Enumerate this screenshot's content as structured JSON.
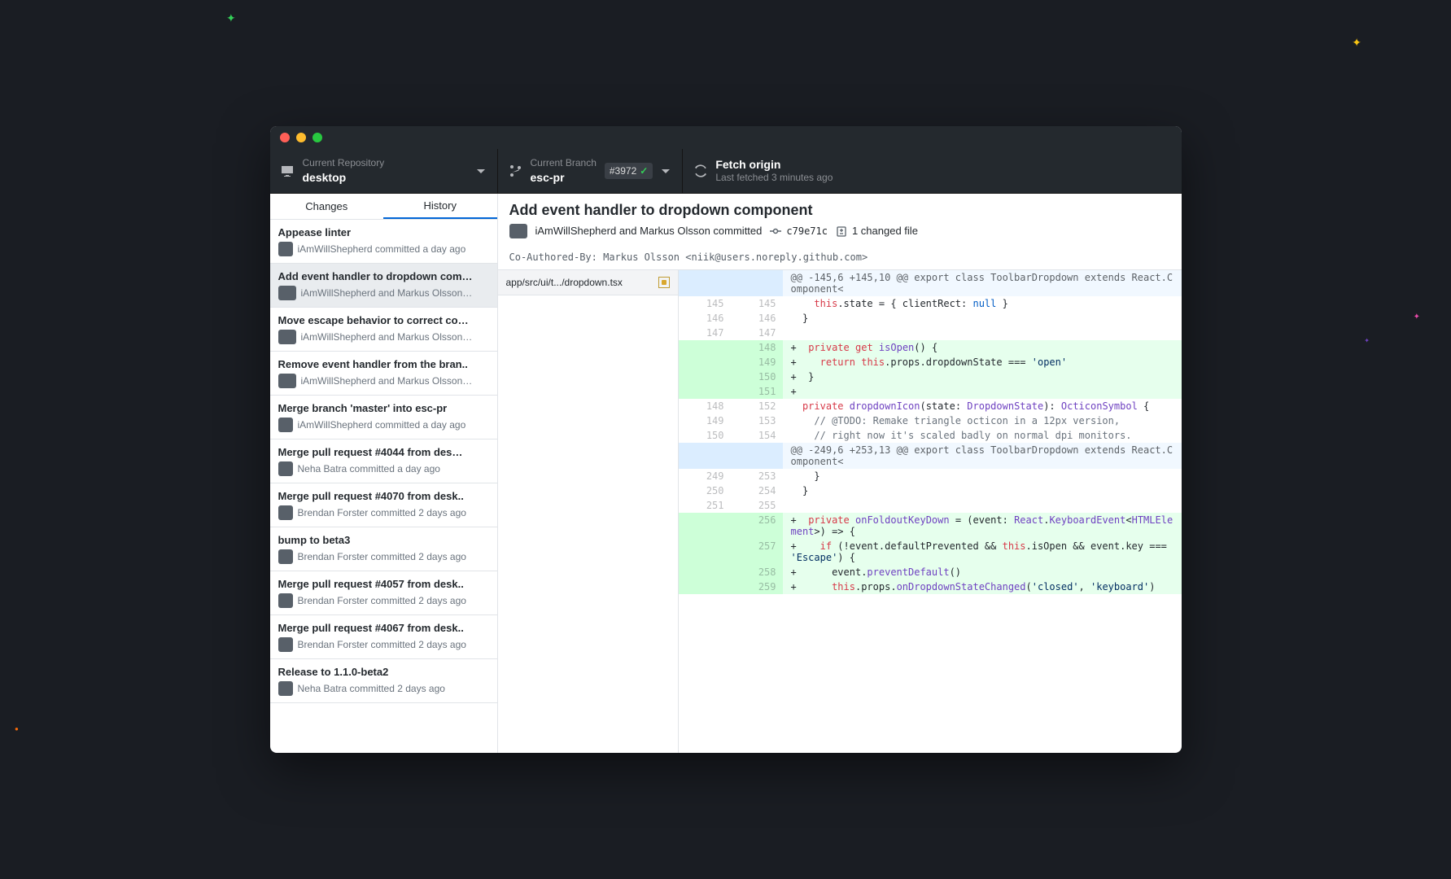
{
  "toolbar": {
    "repo_label": "Current Repository",
    "repo_name": "desktop",
    "branch_label": "Current Branch",
    "branch_name": "esc-pr",
    "pr_number": "#3972",
    "fetch_title": "Fetch origin",
    "fetch_sub": "Last fetched 3 minutes ago"
  },
  "tabs": {
    "changes": "Changes",
    "history": "History"
  },
  "commits": [
    {
      "title": "Appease linter",
      "meta": "iAmWillShepherd committed a day ago",
      "pair": false
    },
    {
      "title": "Add event handler to dropdown com…",
      "meta": "iAmWillShepherd and Markus Olsson…",
      "pair": true,
      "selected": true
    },
    {
      "title": "Move escape behavior to correct co…",
      "meta": "iAmWillShepherd and Markus Olsson…",
      "pair": true
    },
    {
      "title": "Remove event handler from the bran..",
      "meta": "iAmWillShepherd and Markus Olsson…",
      "pair": true
    },
    {
      "title": "Merge branch 'master' into esc-pr",
      "meta": "iAmWillShepherd committed a day ago",
      "pair": false
    },
    {
      "title": "Merge pull request #4044 from des…",
      "meta": "Neha Batra committed a day ago",
      "pair": false
    },
    {
      "title": "Merge pull request #4070 from desk..",
      "meta": "Brendan Forster committed 2 days ago",
      "pair": false
    },
    {
      "title": "bump to beta3",
      "meta": "Brendan Forster committed 2 days ago",
      "pair": false
    },
    {
      "title": "Merge pull request #4057 from desk..",
      "meta": "Brendan Forster committed 2 days ago",
      "pair": false
    },
    {
      "title": "Merge pull request #4067 from desk..",
      "meta": "Brendan Forster committed 2 days ago",
      "pair": false
    },
    {
      "title": "Release to 1.1.0-beta2",
      "meta": "Neha Batra committed 2 days ago",
      "pair": false
    }
  ],
  "detail": {
    "title": "Add event handler to dropdown component",
    "authors": "iAmWillShepherd and Markus Olsson committed",
    "sha": "c79e71c",
    "changed": "1 changed file",
    "message": "Co-Authored-By: Markus Olsson <niik@users.noreply.github.com>",
    "file": "app/src/ui/t.../dropdown.tsx"
  },
  "diff": [
    {
      "t": "hunk",
      "old": "",
      "new": "",
      "text": "@@ -145,6 +145,10 @@ export class ToolbarDropdown extends React.Component<"
    },
    {
      "t": "ctx",
      "old": "145",
      "new": "145",
      "html": "    <span class='kw'>this</span>.state = { clientRect: <span class='num'>null</span> }"
    },
    {
      "t": "ctx",
      "old": "146",
      "new": "146",
      "html": "  }"
    },
    {
      "t": "ctx",
      "old": "147",
      "new": "147",
      "html": ""
    },
    {
      "t": "add",
      "old": "",
      "new": "148",
      "html": "+  <span class='kw'>private</span> <span class='kw'>get</span> <span class='fn'>isOpen</span>() {"
    },
    {
      "t": "add",
      "old": "",
      "new": "149",
      "html": "+    <span class='kw'>return</span> <span class='kw'>this</span>.props.dropdownState === <span class='str'>'open'</span>"
    },
    {
      "t": "add",
      "old": "",
      "new": "150",
      "html": "+  }"
    },
    {
      "t": "add",
      "old": "",
      "new": "151",
      "html": "+"
    },
    {
      "t": "ctx",
      "old": "148",
      "new": "152",
      "html": "  <span class='kw'>private</span> <span class='fn'>dropdownIcon</span>(state: <span class='typ'>DropdownState</span>): <span class='typ'>OcticonSymbol</span> {"
    },
    {
      "t": "ctx",
      "old": "149",
      "new": "153",
      "html": "    <span class='com'>// @TODO: Remake triangle octicon in a 12px version,</span>"
    },
    {
      "t": "ctx",
      "old": "150",
      "new": "154",
      "html": "    <span class='com'>// right now it's scaled badly on normal dpi monitors.</span>"
    },
    {
      "t": "hunk",
      "old": "",
      "new": "",
      "text": "@@ -249,6 +253,13 @@ export class ToolbarDropdown extends React.Component<"
    },
    {
      "t": "ctx",
      "old": "249",
      "new": "253",
      "html": "    }"
    },
    {
      "t": "ctx",
      "old": "250",
      "new": "254",
      "html": "  }"
    },
    {
      "t": "ctx",
      "old": "251",
      "new": "255",
      "html": ""
    },
    {
      "t": "add",
      "old": "",
      "new": "256",
      "html": "+  <span class='kw'>private</span> <span class='fn'>onFoldoutKeyDown</span> = (event: <span class='typ'>React</span>.<span class='typ'>KeyboardEvent</span>&lt;<span class='typ'>HTMLElement</span>&gt;) =&gt; {"
    },
    {
      "t": "add",
      "old": "",
      "new": "257",
      "html": "+    <span class='kw'>if</span> (!event.defaultPrevented &amp;&amp; <span class='kw'>this</span>.isOpen &amp;&amp; event.key === <span class='str'>'Escape'</span>) {"
    },
    {
      "t": "add",
      "old": "",
      "new": "258",
      "html": "+      event.<span class='fn'>preventDefault</span>()"
    },
    {
      "t": "add",
      "old": "",
      "new": "259",
      "html": "+      <span class='kw'>this</span>.props.<span class='fn'>onDropdownStateChanged</span>(<span class='str'>'closed'</span>, <span class='str'>'keyboard'</span>)"
    }
  ]
}
